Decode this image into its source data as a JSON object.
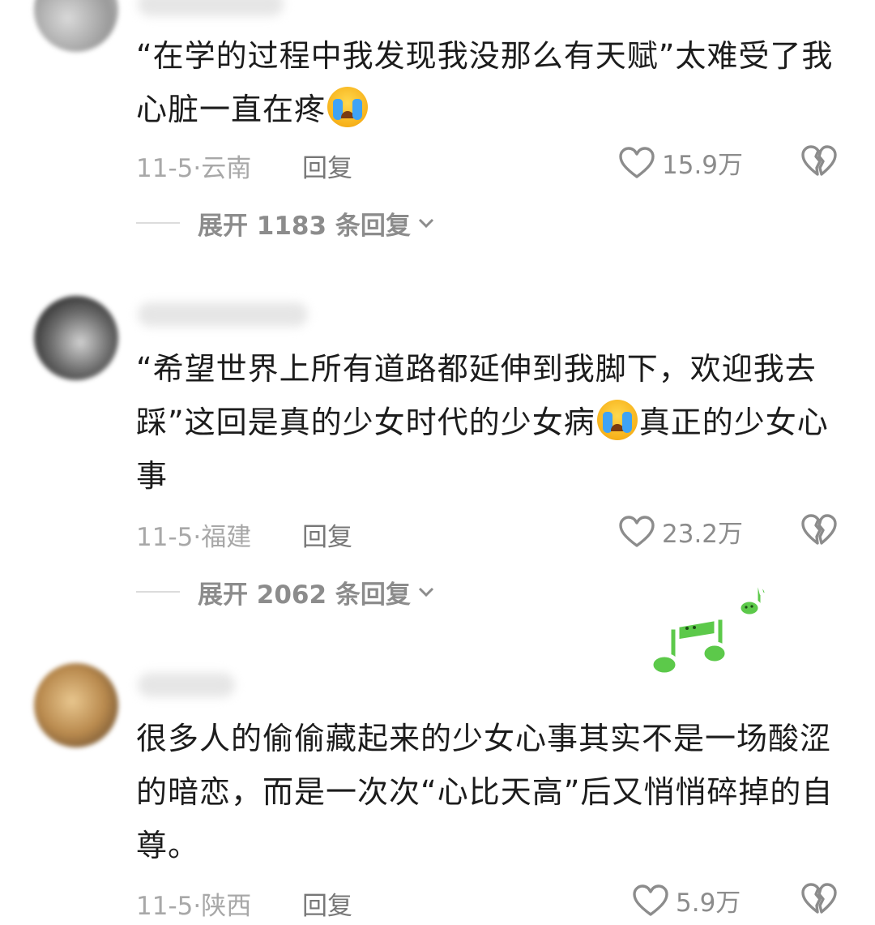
{
  "comments": [
    {
      "text_before_emoji": "“在学的过程中我发现我没那么有天赋”太难受了我心脏一直在疼",
      "text_after_emoji": "",
      "emoji": "loudly-crying-face",
      "date_location": "11-5·云南",
      "reply_label": "回复",
      "like_count": "15.9万",
      "expand_label": "展开 1183 条回复"
    },
    {
      "text_before_emoji": "“希望世界上所有道路都延伸到我脚下，欢迎我去踩”这回是真的少女时代的少女病",
      "text_after_emoji": "真正的少女心事",
      "emoji": "loudly-crying-face",
      "date_location": "11-5·福建",
      "reply_label": "回复",
      "like_count": "23.2万",
      "expand_label": "展开 2062 条回复"
    },
    {
      "text_before_emoji": "很多人的偷偷藏起来的少女心事其实不是一场酸涩的暗恋，而是一次次“心比天高”后又悄悄碎掉的自尊。",
      "text_after_emoji": "",
      "emoji": "",
      "date_location": "11-5·陕西",
      "reply_label": "回复",
      "like_count": "5.9万",
      "expand_label": ""
    }
  ],
  "icons": {
    "like": "heart-outline-icon",
    "dislike": "broken-heart-icon",
    "expand": "chevron-down-icon",
    "sticker": "music-notes-sticker"
  },
  "colors": {
    "sticker_green": "#5cc94a",
    "emoji_yellow": "#f7b21b",
    "tear_blue": "#3fa3f5"
  }
}
